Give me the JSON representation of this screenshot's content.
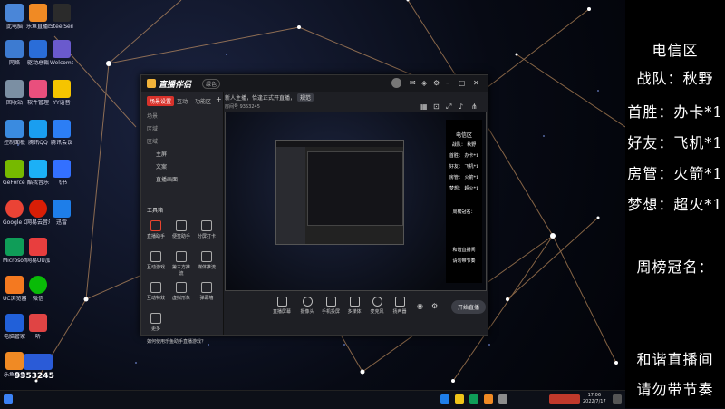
{
  "desktop": {
    "icons": [
      {
        "label": "此电脑",
        "color": "#4a86d8"
      },
      {
        "label": "乐鱼直播助手",
        "color": "#f08a24"
      },
      {
        "label": "SteelSeries GG Laun...",
        "color": "#2b2b2b"
      },
      {
        "label": "网络",
        "color": "#3d7bd1"
      },
      {
        "label": "驱动总裁",
        "color": "#2a6dd8"
      },
      {
        "label": "Welcome",
        "color": "#6a5acd"
      },
      {
        "label": "回收站",
        "color": "#7b8fa3"
      },
      {
        "label": "软件管理",
        "color": "#e94f7d"
      },
      {
        "label": "YY语音",
        "color": "#f5c400"
      },
      {
        "label": "控制面板",
        "color": "#3a8be0"
      },
      {
        "label": "腾讯QQ",
        "color": "#1a9ef0"
      },
      {
        "label": "腾讯会议",
        "color": "#2c7ef5"
      },
      {
        "label": "GeForce Experience",
        "color": "#76b900"
      },
      {
        "label": "酷我音乐",
        "color": "#1cb0f6"
      },
      {
        "label": "飞书",
        "color": "#3370ff"
      },
      {
        "label": "Google Chrome",
        "color": "#ea4335"
      },
      {
        "label": "网易云音乐",
        "color": "#d81e06"
      },
      {
        "label": "迅雷",
        "color": "#1e7ee9"
      },
      {
        "label": "Microsoft Edge",
        "color": "#0f9d58"
      },
      {
        "label": "网易UU加速器",
        "color": "#e83e3e"
      },
      {
        "label": "UC浏览器",
        "color": "#f47920"
      },
      {
        "label": "微信",
        "color": "#09bb07"
      },
      {
        "label": "电脑管家",
        "color": "#2160d9"
      },
      {
        "label": "听",
        "color": "#e04444"
      },
      {
        "label": "乐鱼直播",
        "color": "#f08a24"
      }
    ]
  },
  "app": {
    "name": "直播伴侣",
    "version": "绿色",
    "tabs": [
      "场景设置",
      "互动",
      "功能区"
    ],
    "scenes": [
      "场景",
      "区域",
      "区域",
      "主屏",
      "文案",
      "直播画面"
    ],
    "tools_title": "工具箱",
    "tools": [
      "直播助手",
      "便签助手",
      "分屏打卡",
      "互动游戏",
      "第三方推流",
      "媒体推流",
      "互动特效",
      "虚拟形象",
      "弹幕墙",
      "更多"
    ],
    "notice": "如何使用乐鱼助手直播游戏？",
    "topbar_text": "新人主播，恰逢正式开直播，",
    "topbar_tag": "规范",
    "room_label": "房间号",
    "room_number": "9353245",
    "bottom_tools": [
      "直播屏幕",
      "摄像头",
      "手机投屏",
      "多媒体",
      "麦克风",
      "扬声器"
    ],
    "live_button": "开始直播"
  },
  "overlay": {
    "region": "电信区",
    "rows": [
      {
        "label": "战队：",
        "value": "秋野"
      },
      {
        "label": "首胜：",
        "value": "办卡*1"
      },
      {
        "label": "好友：",
        "value": "飞机*1"
      },
      {
        "label": "房管：",
        "value": "火箭*1"
      },
      {
        "label": "梦想：",
        "value": "超火*1"
      }
    ],
    "weekly_title": "周榜冠名：",
    "footer1": "和谐直播间",
    "footer2": "请勿带节奏"
  },
  "mini_overlay": {
    "region": "电信区",
    "rows": [
      "战队：  秋野",
      "首胜：  办卡*1",
      "好友：  飞机*1",
      "房管：  火箭*1",
      "梦想：  超火*1"
    ],
    "weekly_title": "周榜冠名：",
    "footer1": "和谐直播间",
    "footer2": "请勿带节奏"
  },
  "watermark": {
    "number": "9353245"
  },
  "taskbar": {
    "time": "17:06",
    "date": "2022/7/17"
  }
}
